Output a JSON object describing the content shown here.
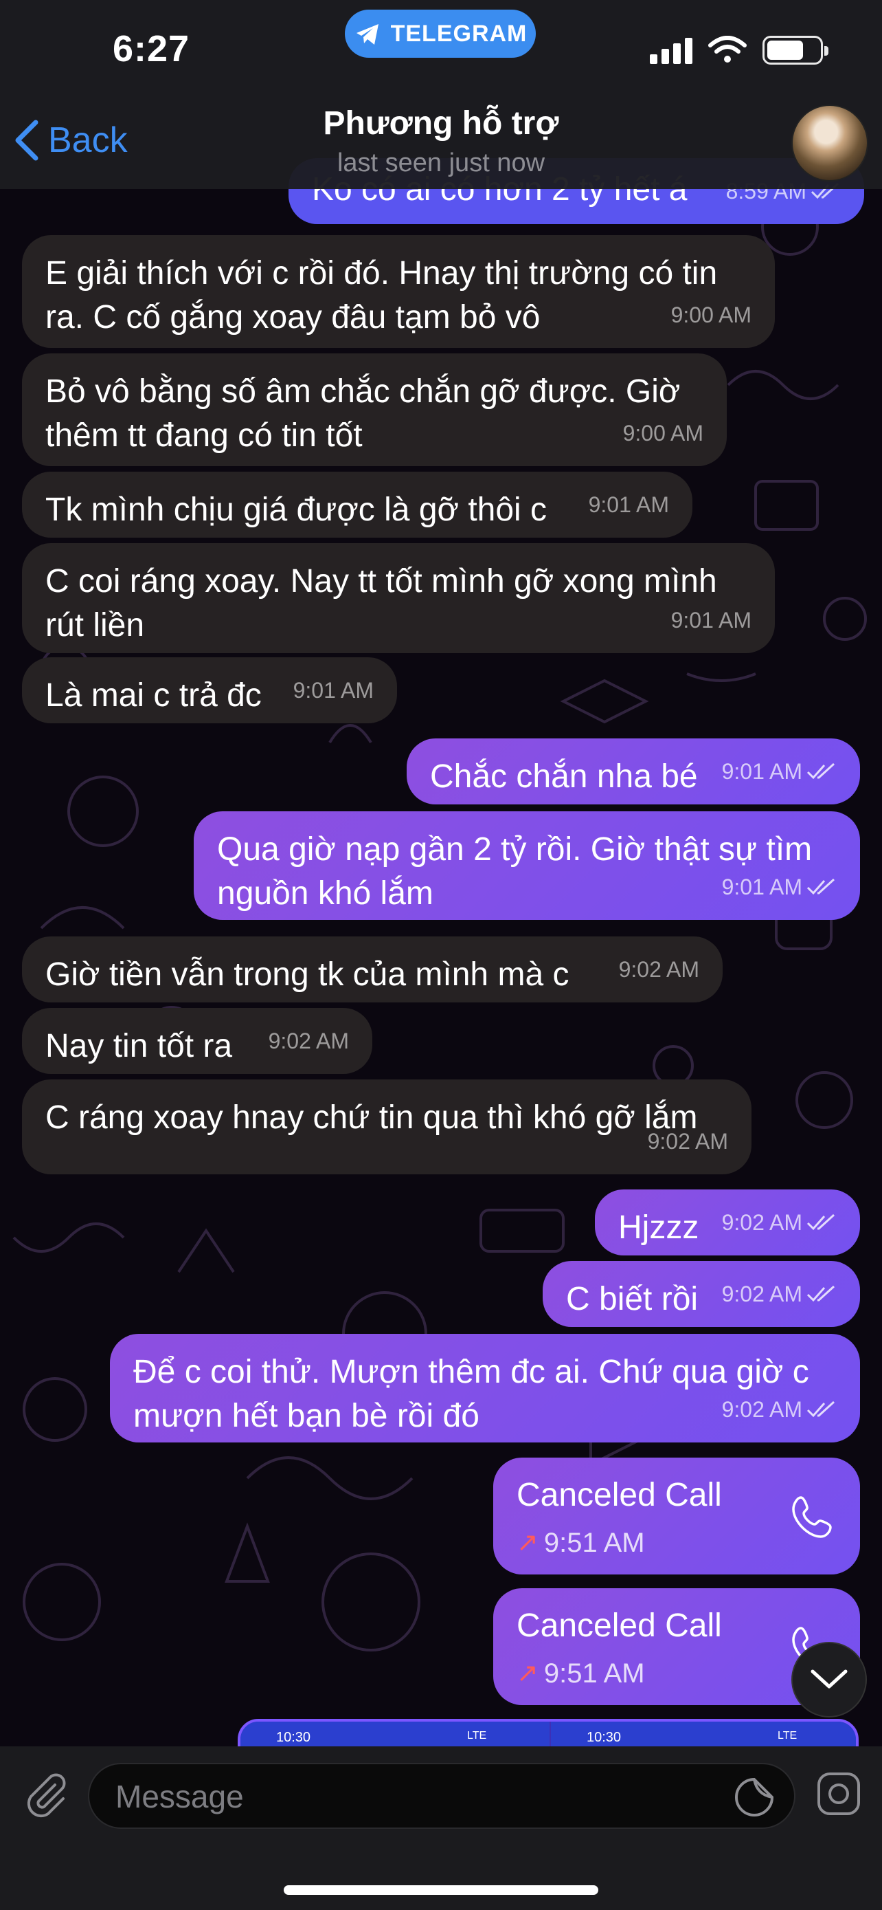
{
  "status_bar": {
    "time": "6:27",
    "pill_label": "TELEGRAM"
  },
  "header": {
    "back_label": "Back",
    "contact_name": "Phương hỗ trợ",
    "contact_status": "last seen just now"
  },
  "messages": [
    {
      "dir": "out",
      "text": "Ko có ai có hơn 2 tỷ hết á",
      "time": "8:59 AM"
    },
    {
      "dir": "in",
      "text": "E giải thích với c rồi đó. Hnay thị trường có tin ra. C cố gắng xoay đâu tạm bỏ vô",
      "time": "9:00 AM"
    },
    {
      "dir": "in",
      "text": "Bỏ vô bằng số âm chắc chắn gỡ được. Giờ thêm tt đang có tin tốt",
      "time": "9:00 AM"
    },
    {
      "dir": "in",
      "text": "Tk mình chịu giá được là gỡ thôi c",
      "time": "9:01 AM"
    },
    {
      "dir": "in",
      "text": "C coi ráng xoay. Nay tt tốt mình gỡ xong mình rút liền",
      "time": "9:01 AM"
    },
    {
      "dir": "in",
      "text": "Là mai c trả đc",
      "time": "9:01 AM"
    },
    {
      "dir": "out",
      "text": "Chắc chắn nha bé",
      "time": "9:01 AM"
    },
    {
      "dir": "out",
      "text": "Qua giờ nạp gần 2 tỷ rồi. Giờ thật sự tìm nguồn khó lắm",
      "time": "9:01 AM"
    },
    {
      "dir": "in",
      "text": "Giờ tiền vẫn trong tk của mình mà c",
      "time": "9:02 AM"
    },
    {
      "dir": "in",
      "text": "Nay tin tốt ra",
      "time": "9:02 AM"
    },
    {
      "dir": "in",
      "text": "C ráng xoay hnay chứ tin qua thì khó gỡ lắm",
      "time": "9:02 AM"
    },
    {
      "dir": "out",
      "text": "Hjzzz",
      "time": "9:02 AM"
    },
    {
      "dir": "out",
      "text": "C biết rồi",
      "time": "9:02 AM"
    },
    {
      "dir": "out",
      "text": "Để c coi thử. Mượn thêm đc ai. Chứ qua giờ c mượn hết bạn bè rồi đó",
      "time": "9:02 AM"
    }
  ],
  "calls": [
    {
      "title": "Canceled Call",
      "time": "9:51 AM"
    },
    {
      "title": "Canceled Call",
      "time": "9:51 AM"
    }
  ],
  "media_preview": {
    "left_time": "10:30",
    "right_time": "10:30",
    "network": "LTE"
  },
  "composer": {
    "placeholder": "Message"
  },
  "colors": {
    "accent": "#3f8ef3",
    "incoming_bubble": "#262223",
    "outgoing_bubble": "#7a52ea",
    "missed_call_arrow": "#ff5b5b"
  },
  "icons": [
    "telegram-plane-icon",
    "signal-icon",
    "wifi-icon",
    "battery-icon",
    "back-chevron-icon",
    "double-check-icon",
    "phone-icon",
    "chevron-down-icon",
    "paperclip-icon",
    "sticker-icon",
    "camera-icon"
  ]
}
